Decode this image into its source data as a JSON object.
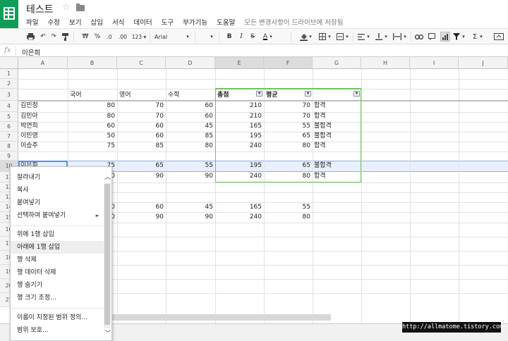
{
  "app": {
    "title": "테스트",
    "save_status": "모든 변경사항이 드라이브에 저장됨"
  },
  "menu": [
    "파일",
    "수정",
    "보기",
    "삽입",
    "서식",
    "데이터",
    "도구",
    "부가기능",
    "도움말"
  ],
  "toolbar": {
    "currency": "₩",
    "percent": "%",
    "decimal_less": ".0",
    "decimal_more": ".00",
    "format_more": "123",
    "font": "Arial",
    "bold": "B",
    "italic": "I",
    "strike": "S",
    "text_color": "A",
    "sigma": "Σ"
  },
  "formula": {
    "fx": "fx",
    "value": "이은희"
  },
  "columns": [
    "A",
    "B",
    "C",
    "D",
    "E",
    "F",
    "G",
    "H",
    "I",
    "J"
  ],
  "rows": [
    "1",
    "2",
    "3",
    "4",
    "5",
    "6",
    "7",
    "8",
    "9",
    "10",
    "11",
    "12",
    "13",
    "14",
    "15",
    "16",
    "17",
    "18",
    "19",
    "20",
    "21"
  ],
  "headers": {
    "kor": "국어",
    "eng": "영어",
    "math": "수학",
    "total": "총점",
    "avg": "평균"
  },
  "table": [
    {
      "name": "김민정",
      "kor": "80",
      "eng": "70",
      "math": "60",
      "total": "210",
      "avg": "70",
      "result": "합격"
    },
    {
      "name": "김민아",
      "kor": "80",
      "eng": "70",
      "math": "60",
      "total": "210",
      "avg": "70",
      "result": "합격"
    },
    {
      "name": "박연희",
      "kor": "60",
      "eng": "60",
      "math": "45",
      "total": "165",
      "avg": "55",
      "result": "불합격"
    },
    {
      "name": "이민영",
      "kor": "50",
      "eng": "60",
      "math": "85",
      "total": "195",
      "avg": "65",
      "result": "불합격"
    },
    {
      "name": "이승주",
      "kor": "75",
      "eng": "85",
      "math": "80",
      "total": "240",
      "avg": "80",
      "result": "합격"
    }
  ],
  "row10": {
    "name": "이은희",
    "kor": "75",
    "eng": "65",
    "math": "55",
    "total": "195",
    "avg": "65",
    "result": "불합격"
  },
  "row11": {
    "kor": "0",
    "eng": "90",
    "math": "90",
    "total": "240",
    "avg": "80",
    "result": "합격"
  },
  "row14": {
    "kor": "0",
    "eng": "60",
    "math": "45",
    "total": "165",
    "avg": "55"
  },
  "row15": {
    "kor": "0",
    "eng": "90",
    "math": "90",
    "total": "240",
    "avg": "80"
  },
  "context_menu": {
    "cut": "잘라내기",
    "copy": "복사",
    "paste": "붙여넣기",
    "paste_special": "선택하여 붙여넣기",
    "insert_above": "위에 1행 삽입",
    "insert_below": "아래에 1행 삽입",
    "delete_row": "행 삭제",
    "clear_row": "행 데이터 삭제",
    "hide_row": "행 숨기기",
    "resize_row": "행 크기 조정...",
    "named_range": "이름이 지정된 범위 정의...",
    "protect_range": "범위 보호..."
  },
  "watermark": "http://allmatome.tistory.com",
  "colors": {
    "brand_green": "#0f9d58",
    "filter_border": "#6fc35a",
    "selection_blue": "#4d90fe"
  }
}
